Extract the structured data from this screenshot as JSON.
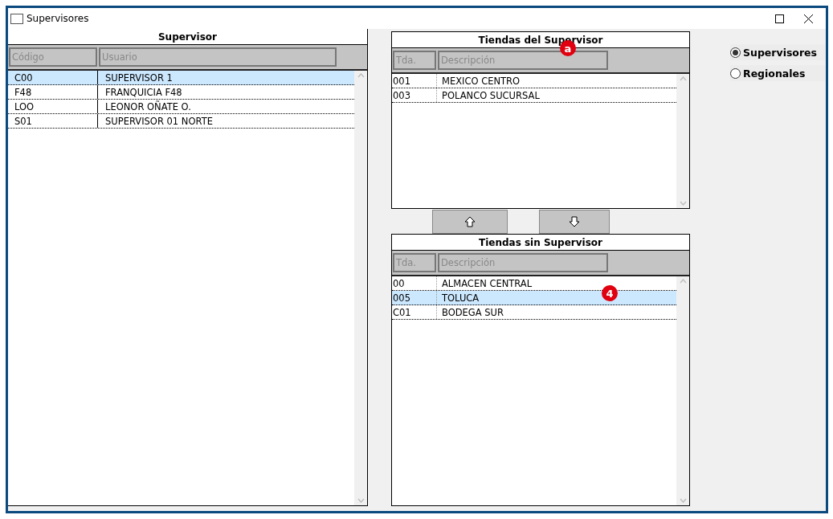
{
  "window": {
    "title": "Supervisores"
  },
  "supervisor_table": {
    "title": "Supervisor",
    "columns": [
      "Código",
      "Usuario"
    ],
    "rows": [
      {
        "cells": [
          "C00",
          "SUPERVISOR 1"
        ],
        "selected": true
      },
      {
        "cells": [
          "F48",
          "FRANQUICIA F48"
        ],
        "selected": false
      },
      {
        "cells": [
          "LOO",
          "LEONOR OÑATE O."
        ],
        "selected": false
      },
      {
        "cells": [
          "S01",
          "SUPERVISOR 01 NORTE"
        ],
        "selected": false
      }
    ]
  },
  "assigned_stores": {
    "title": "Tiendas del Supervisor",
    "callout": "a",
    "columns": [
      "Tda.",
      "Descripción"
    ],
    "rows": [
      {
        "cells": [
          "001",
          "MEXICO CENTRO"
        ],
        "selected": false
      },
      {
        "cells": [
          "003",
          "POLANCO SUCURSAL"
        ],
        "selected": false
      }
    ]
  },
  "unassigned_stores": {
    "title": "Tiendas sin Supervisor",
    "callout": "4",
    "columns": [
      "Tda.",
      "Descripción"
    ],
    "rows": [
      {
        "cells": [
          "00",
          "ALMACEN CENTRAL"
        ],
        "selected": false
      },
      {
        "cells": [
          "005",
          "TOLUCA"
        ],
        "selected": true
      },
      {
        "cells": [
          "C01",
          "BODEGA SUR"
        ],
        "selected": false
      }
    ]
  },
  "mode": [
    {
      "label": "Supervisores",
      "selected": true
    },
    {
      "label": "Regionales",
      "selected": false
    }
  ]
}
